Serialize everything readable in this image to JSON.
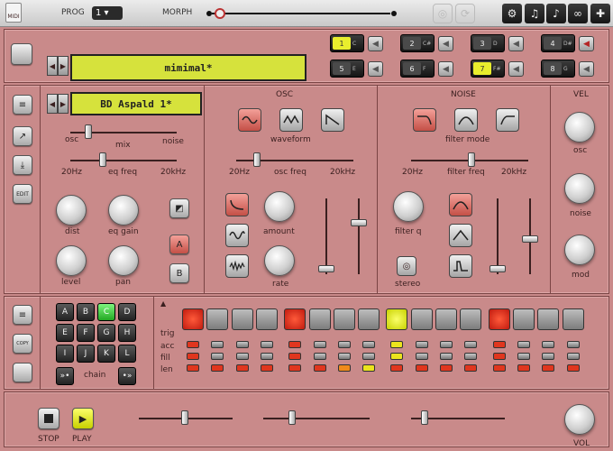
{
  "topbar": {
    "icon": "MIDI",
    "prog_label": "PROG",
    "prog_value": "1",
    "morph_label": "MORPH"
  },
  "patterns": [
    {
      "num": "1",
      "note": "C",
      "lit": true,
      "mute_red": false
    },
    {
      "num": "2",
      "note": "C#",
      "lit": false,
      "mute_red": false
    },
    {
      "num": "3",
      "note": "D",
      "lit": false,
      "mute_red": false
    },
    {
      "num": "4",
      "note": "D#",
      "lit": false,
      "mute_red": true
    },
    {
      "num": "5",
      "note": "E",
      "lit": false,
      "mute_red": false
    },
    {
      "num": "6",
      "note": "F",
      "lit": false,
      "mute_red": false
    },
    {
      "num": "7",
      "note": "F#",
      "lit": true,
      "mute_red": false
    },
    {
      "num": "8",
      "note": "G",
      "lit": false,
      "mute_red": false
    }
  ],
  "kit_name": "mimimal*",
  "sound_name": "BD Aspald 1*",
  "side": {
    "edit_label": "EDIT",
    "copy_label": "COPY"
  },
  "voice": {
    "osc": "osc",
    "mix": "mix",
    "noise": "noise",
    "f20": "20Hz",
    "eqfreq": "eq freq",
    "f20k": "20kHz",
    "dist": "dist",
    "eqgain": "eq gain",
    "level": "level",
    "pan": "pan",
    "a": "A",
    "b": "B"
  },
  "osc": {
    "title": "OSC",
    "waveform": "waveform",
    "f20": "20Hz",
    "freq": "osc freq",
    "f20k": "20kHz",
    "amount": "amount",
    "rate": "rate"
  },
  "noise": {
    "title": "NOISE",
    "filtermode": "filter mode",
    "f20": "20Hz",
    "freq": "filter freq",
    "f20k": "20kHz",
    "filterq": "filter q",
    "stereo": "stereo"
  },
  "vel": {
    "title": "VEL",
    "osc": "osc",
    "noise": "noise",
    "mod": "mod"
  },
  "keys": [
    "A",
    "B",
    "C",
    "D",
    "E",
    "F",
    "G",
    "H",
    "I",
    "J",
    "K",
    "L"
  ],
  "active_key": "C",
  "chain": {
    "label": "chain",
    "left": "»•",
    "right": "•»"
  },
  "seq": {
    "rows": [
      "trig",
      "acc",
      "fill",
      "len"
    ],
    "steps": [
      "red",
      "",
      "",
      "",
      "red",
      "",
      "",
      "",
      "yel",
      "",
      "",
      "",
      "red",
      "",
      "",
      ""
    ],
    "acc": [
      "red",
      "",
      "",
      "",
      "red",
      "",
      "",
      "",
      "yel",
      "",
      "",
      "",
      "red",
      "",
      "",
      ""
    ],
    "fill": [
      "red",
      "",
      "",
      "",
      "red",
      "",
      "",
      "",
      "yel",
      "",
      "",
      "",
      "red",
      "",
      "",
      ""
    ],
    "len": [
      "red",
      "red",
      "red",
      "red",
      "red",
      "red",
      "org",
      "yel",
      "red",
      "red",
      "red",
      "red",
      "red",
      "red",
      "red",
      "red"
    ]
  },
  "transport": {
    "stop": "STOP",
    "play": "PLAY",
    "vol": "VOL"
  }
}
